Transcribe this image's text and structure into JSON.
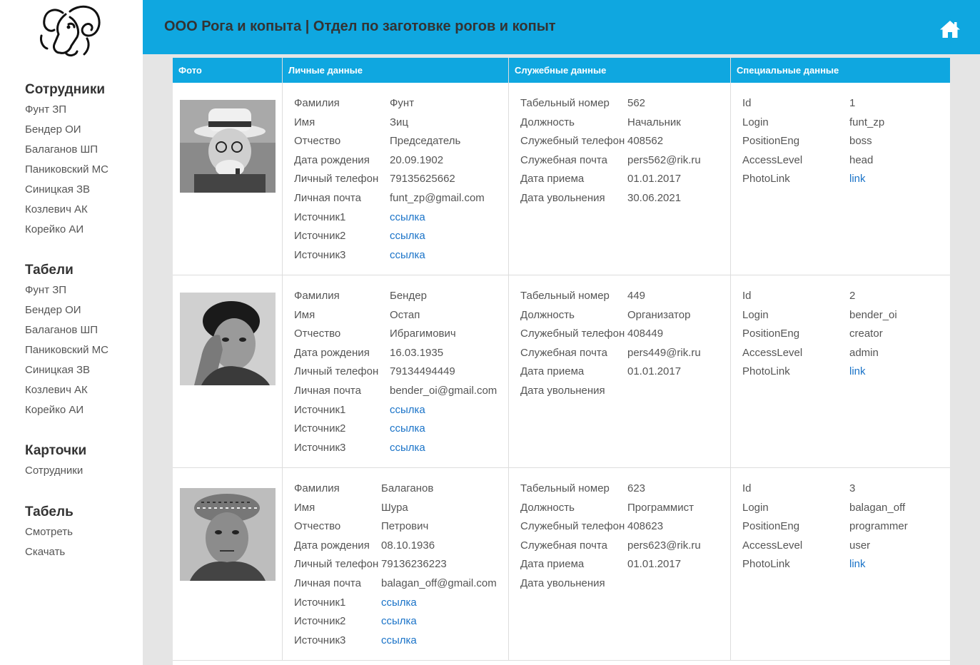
{
  "header": {
    "title": "ООО Рога и копыта | Отдел по заготовке рогов и копыт",
    "home_icon": "home-icon"
  },
  "logo": {
    "icon": "ram-logo"
  },
  "sidebar": {
    "sections": [
      {
        "title": "Сотрудники",
        "items": [
          "Фунт ЗП",
          "Бендер ОИ",
          "Балаганов ШП",
          "Паниковский МС",
          "Синицкая ЗВ",
          "Козлевич АК",
          "Корейко АИ"
        ]
      },
      {
        "title": "Табели",
        "items": [
          "Фунт ЗП",
          "Бендер ОИ",
          "Балаганов ШП",
          "Паниковский МС",
          "Синицкая ЗВ",
          "Козлевич АК",
          "Корейко АИ"
        ]
      },
      {
        "title": "Карточки",
        "items": [
          "Сотрудники"
        ]
      },
      {
        "title": "Табель",
        "items": [
          "Смотреть",
          "Скачать"
        ]
      }
    ]
  },
  "table": {
    "columns": [
      "Фото",
      "Личные данные",
      "Служебные данные",
      "Специальные данные"
    ],
    "personal_labels": [
      "Фамилия",
      "Имя",
      "Отчество",
      "Дата рождения",
      "Личный телефон",
      "Личная почта",
      "Источник1",
      "Источник2",
      "Источник3"
    ],
    "work_labels": [
      "Табельный номер",
      "Должность",
      "Служебный телефон",
      "Служебная почта",
      "Дата приема",
      "Дата увольнения"
    ],
    "special_labels": [
      "Id",
      "Login",
      "PositionEng",
      "AccessLevel",
      "PhotoLink"
    ],
    "rows": [
      {
        "personal": [
          "Фунт",
          "Зиц",
          "Председатель",
          "20.09.1902",
          "79135625662",
          "funt_zp@gmail.com",
          "ссылка",
          "ссылка",
          "ссылка"
        ],
        "work": [
          "562",
          "Начальник",
          "408562",
          "pers562@rik.ru",
          "01.01.2017",
          "30.06.2021"
        ],
        "special": [
          "1",
          "funt_zp",
          "boss",
          "head",
          "link"
        ]
      },
      {
        "personal": [
          "Бендер",
          "Остап",
          "Ибрагимович",
          "16.03.1935",
          "79134494449",
          "bender_oi@gmail.com",
          "ссылка",
          "ссылка",
          "ссылка"
        ],
        "work": [
          "449",
          "Организатор",
          "408449",
          "pers449@rik.ru",
          "01.01.2017",
          ""
        ],
        "special": [
          "2",
          "bender_oi",
          "creator",
          "admin",
          "link"
        ]
      },
      {
        "personal": [
          "Балаганов",
          "Шура",
          "Петрович",
          "08.10.1936",
          "79136236223",
          "balagan_off@gmail.com",
          "ссылка",
          "ссылка",
          "ссылка"
        ],
        "work": [
          "623",
          "Программист",
          "408623",
          "pers623@rik.ru",
          "01.01.2017",
          ""
        ],
        "special": [
          "3",
          "balagan_off",
          "programmer",
          "user",
          "link"
        ]
      }
    ]
  },
  "colors": {
    "accent": "#0fa7e0",
    "link": "#1a73c8",
    "text": "#555555",
    "background": "#e5e5e5"
  }
}
